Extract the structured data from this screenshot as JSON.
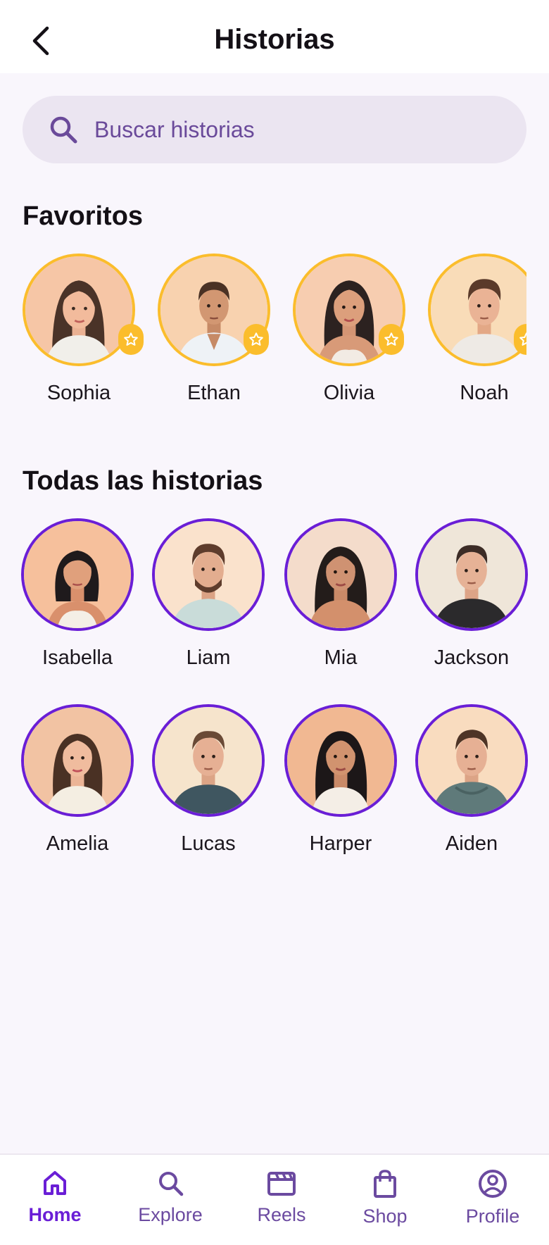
{
  "header": {
    "title": "Historias"
  },
  "search": {
    "placeholder": "Buscar historias"
  },
  "favorites": {
    "title": "Favoritos",
    "items": [
      {
        "name": "Sophia"
      },
      {
        "name": "Ethan"
      },
      {
        "name": "Olivia"
      },
      {
        "name": "Noah"
      }
    ]
  },
  "all_stories": {
    "title": "Todas las historias",
    "items": [
      {
        "name": "Isabella"
      },
      {
        "name": "Liam"
      },
      {
        "name": "Mia"
      },
      {
        "name": "Jackson"
      },
      {
        "name": "Amelia"
      },
      {
        "name": "Lucas"
      },
      {
        "name": "Harper"
      },
      {
        "name": "Aiden"
      }
    ]
  },
  "nav": {
    "items": [
      {
        "label": "Home",
        "icon": "home-icon",
        "active": true
      },
      {
        "label": "Explore",
        "icon": "search-icon",
        "active": false
      },
      {
        "label": "Reels",
        "icon": "clapperboard-icon",
        "active": false
      },
      {
        "label": "Shop",
        "icon": "shopping-bag-icon",
        "active": false
      },
      {
        "label": "Profile",
        "icon": "profile-icon",
        "active": false
      }
    ]
  },
  "colors": {
    "accent": "#6a1ed6",
    "favorite_ring": "#fbbd2c",
    "search_bg": "#ebe5f1",
    "page_bg": "#f9f6fc"
  }
}
